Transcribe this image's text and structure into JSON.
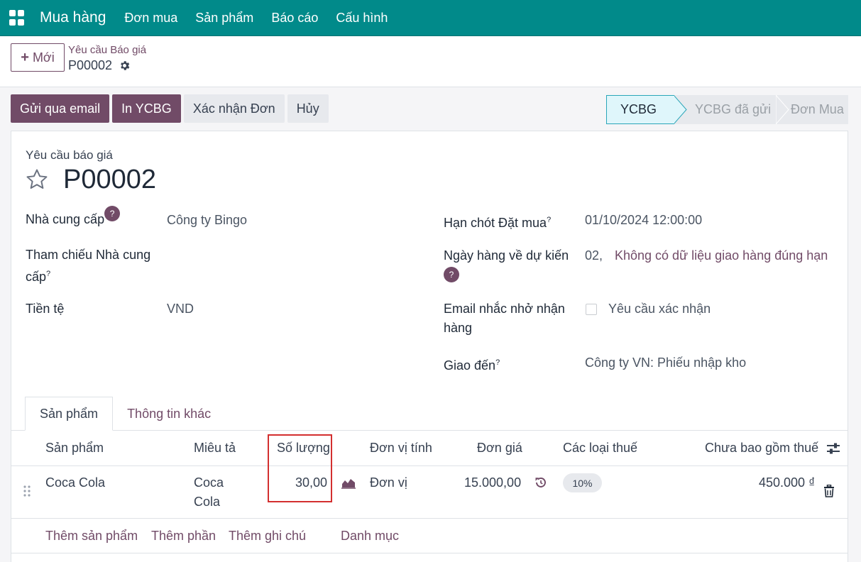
{
  "navbar": {
    "brand": "Mua hàng",
    "menu": [
      "Đơn mua",
      "Sản phẩm",
      "Báo cáo",
      "Cấu hình"
    ]
  },
  "control_panel": {
    "new_button": "Mới",
    "breadcrumb_parent": "Yêu cầu Báo giá",
    "breadcrumb_current": "P00002"
  },
  "actions": {
    "send_email": "Gửi qua email",
    "print": "In YCBG",
    "confirm": "Xác nhận Đơn",
    "cancel": "Hủy"
  },
  "statusbar": {
    "stages": [
      "YCBG",
      "YCBG đã gửi",
      "Đơn Mua"
    ],
    "active": "YCBG"
  },
  "form": {
    "doc_label": "Yêu cầu báo giá",
    "doc_name": "P00002",
    "vendor_label": "Nhà cung cấp",
    "vendor_value": "Công ty Bingo",
    "vendor_ref_label_1": "Tham chiếu Nhà cung",
    "vendor_ref_label_2": "cấp",
    "currency_label": "Tiền tệ",
    "currency_value": "VND",
    "order_deadline_label": "Hạn chót Đặt mua",
    "order_deadline_value": "01/10/2024 12:00:00",
    "expected_arrival_label": "Ngày hàng về dự kiến",
    "expected_arrival_value": "02,",
    "expected_arrival_warning": "Không có dữ liệu giao hàng đúng hạn",
    "reminder_label_1": "Email nhắc nhở nhận",
    "reminder_label_2": "hàng",
    "reminder_checkbox_label": "Yêu cầu xác nhận",
    "deliver_to_label": "Giao đến",
    "deliver_to_value": "Công ty VN: Phiếu nhập kho",
    "help_mark": "?",
    "sup_mark": "?"
  },
  "tabs": [
    "Sản phẩm",
    "Thông tin khác"
  ],
  "table": {
    "headers": {
      "product": "Sản phẩm",
      "description": "Miêu tả",
      "quantity": "Số lượng",
      "uom": "Đơn vị tính",
      "unit_price": "Đơn giá",
      "taxes": "Các loại thuế",
      "subtotal": "Chưa bao gồm thuế"
    },
    "rows": [
      {
        "product": "Coca Cola",
        "description_1": "Coca",
        "description_2": "Cola",
        "quantity": "30,00",
        "uom": "Đơn vị",
        "unit_price": "15.000,00",
        "tax": "10%",
        "subtotal": "450.000 ₫"
      }
    ],
    "add_links": [
      "Thêm sản phẩm",
      "Thêm phần",
      "Thêm ghi chú",
      "Danh mục"
    ]
  },
  "colors": {
    "navbar": "#018a8a",
    "primary": "#714b67",
    "highlight": "#d32f2f"
  }
}
